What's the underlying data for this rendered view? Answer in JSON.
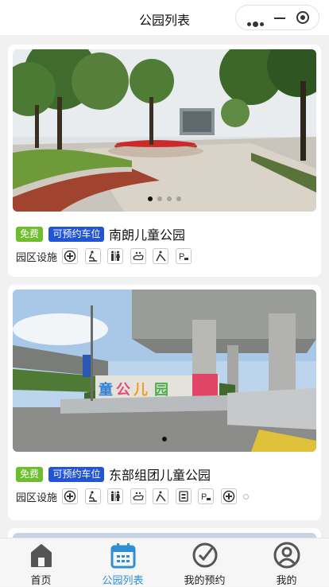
{
  "nav": {
    "title": "公园列表"
  },
  "parks": [
    {
      "name": "南朗儿童公园",
      "badges": {
        "free": "免费",
        "parking": "可预约车位"
      },
      "facility_label": "园区设施",
      "facilities": [
        "first-aid-icon",
        "fitness-icon",
        "restroom-icon",
        "pet-area-icon",
        "slide-icon",
        "parking-icon"
      ],
      "slides": 4,
      "active_slide": 1
    },
    {
      "name": "东部组团儿童公园",
      "badges": {
        "free": "免费",
        "parking": "可预约车位"
      },
      "facility_label": "园区设施",
      "facilities": [
        "first-aid-icon",
        "fitness-icon",
        "restroom-icon",
        "pet-area-icon",
        "slide-icon",
        "info-board-icon",
        "parking-icon",
        "first-aid-icon"
      ],
      "slides": 1,
      "active_slide": 1
    }
  ],
  "tabbar": [
    {
      "label": "首页",
      "icon": "home-icon",
      "active": false
    },
    {
      "label": "公园列表",
      "icon": "calendar-icon",
      "active": true
    },
    {
      "label": "我的预约",
      "icon": "check-circle-icon",
      "active": false
    },
    {
      "label": "我的",
      "icon": "user-icon",
      "active": false
    }
  ],
  "colors": {
    "accent": "#2e8fd7",
    "free_badge": "#6cbe2c",
    "parking_badge": "#2254d8"
  }
}
